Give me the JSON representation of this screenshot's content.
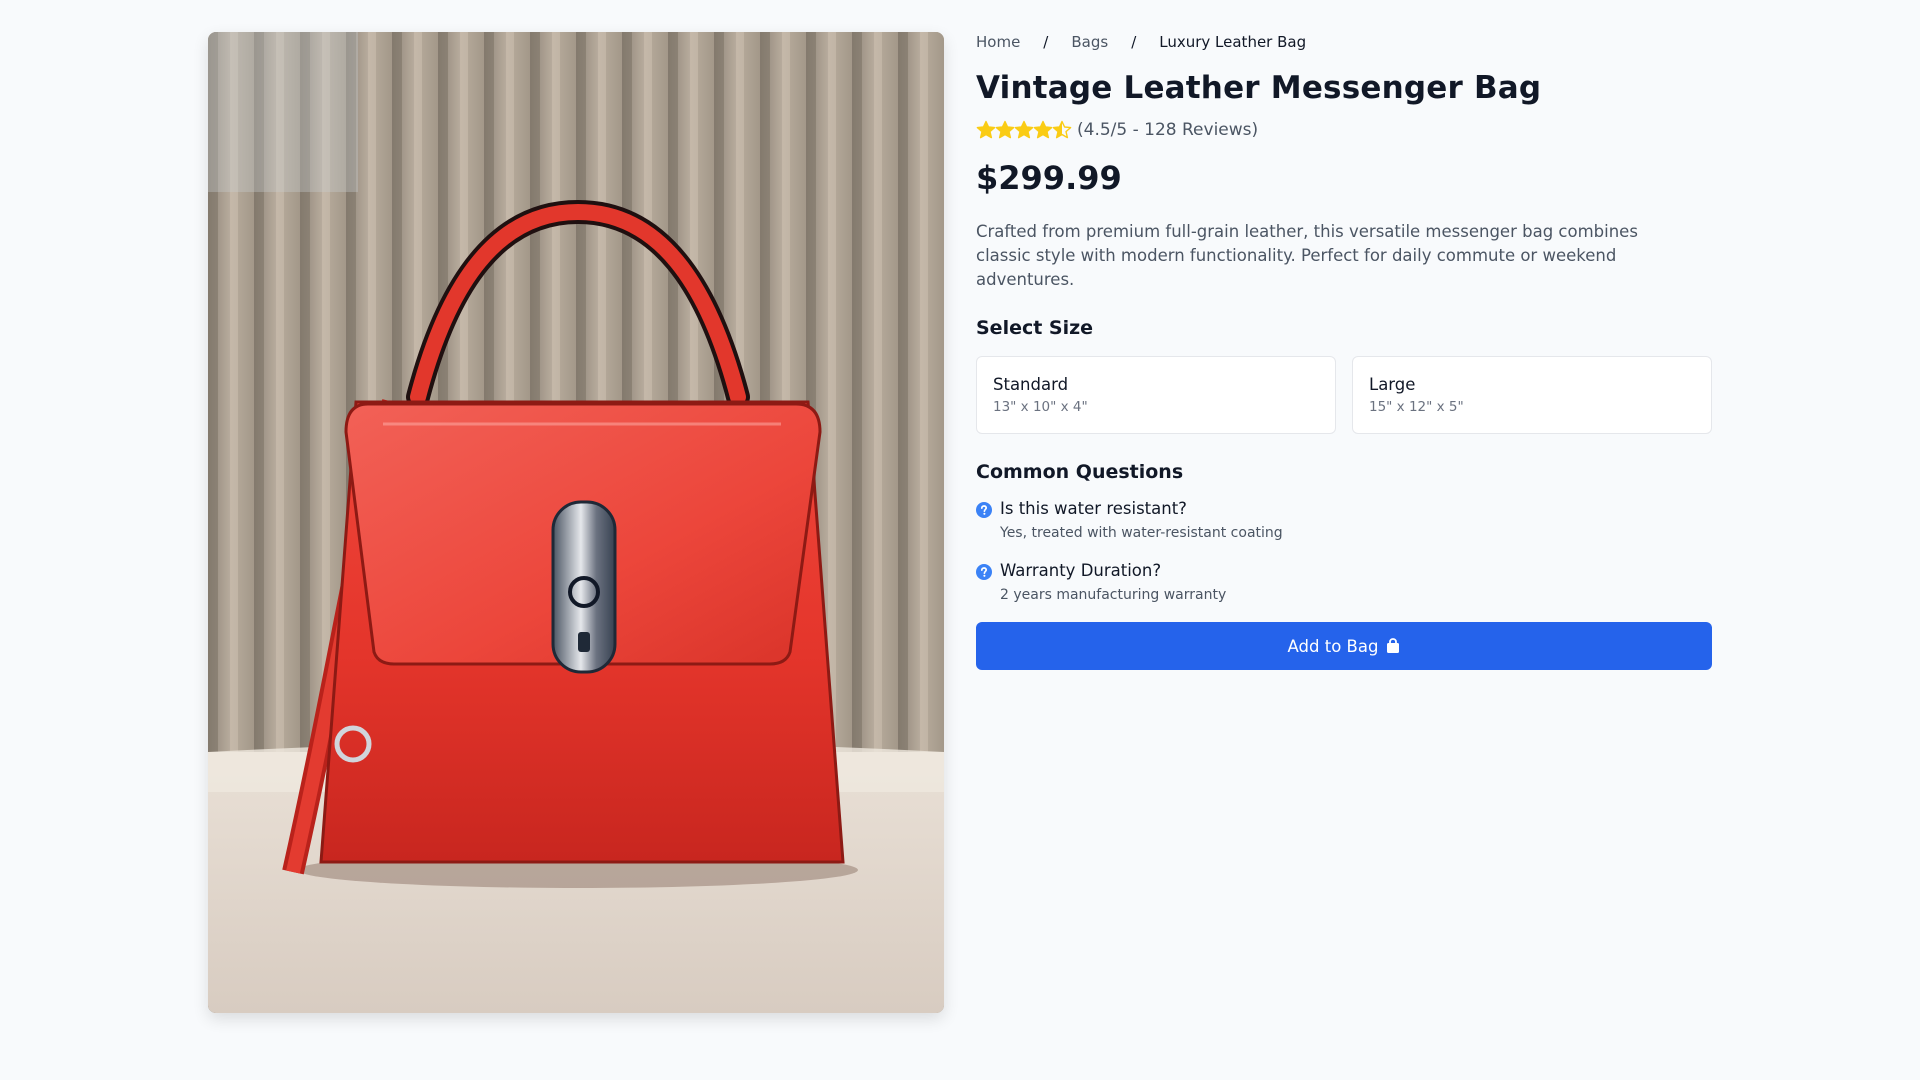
{
  "breadcrumb": {
    "items": [
      {
        "label": "Home"
      },
      {
        "label": "Bags"
      },
      {
        "label": "Luxury Leather Bag"
      }
    ],
    "separator": "/"
  },
  "product": {
    "title": "Vintage Leather Messenger Bag",
    "rating": {
      "value": 4.5,
      "max": 5,
      "text": "(4.5/5 - 128 Reviews)",
      "star_color": "#facc15"
    },
    "price": "$299.99",
    "description": "Crafted from premium full-grain leather, this versatile messenger bag combines classic style with modern functionality. Perfect for daily commute or weekend adventures.",
    "image_icon": "red-leather-handbag-photo"
  },
  "size_section": {
    "heading": "Select Size",
    "options": [
      {
        "name": "Standard",
        "dims": "13\" x 10\" x 4\""
      },
      {
        "name": "Large",
        "dims": "15\" x 12\" x 5\""
      }
    ]
  },
  "faq_section": {
    "heading": "Common Questions",
    "icon": "question-circle-icon",
    "items": [
      {
        "question": "Is this water resistant?",
        "answer": "Yes, treated with water-resistant coating"
      },
      {
        "question": "Warranty Duration?",
        "answer": "2 years manufacturing warranty"
      }
    ]
  },
  "cta": {
    "label": "Add to Bag",
    "icon": "shopping-bag-icon",
    "color": "#2563eb"
  }
}
